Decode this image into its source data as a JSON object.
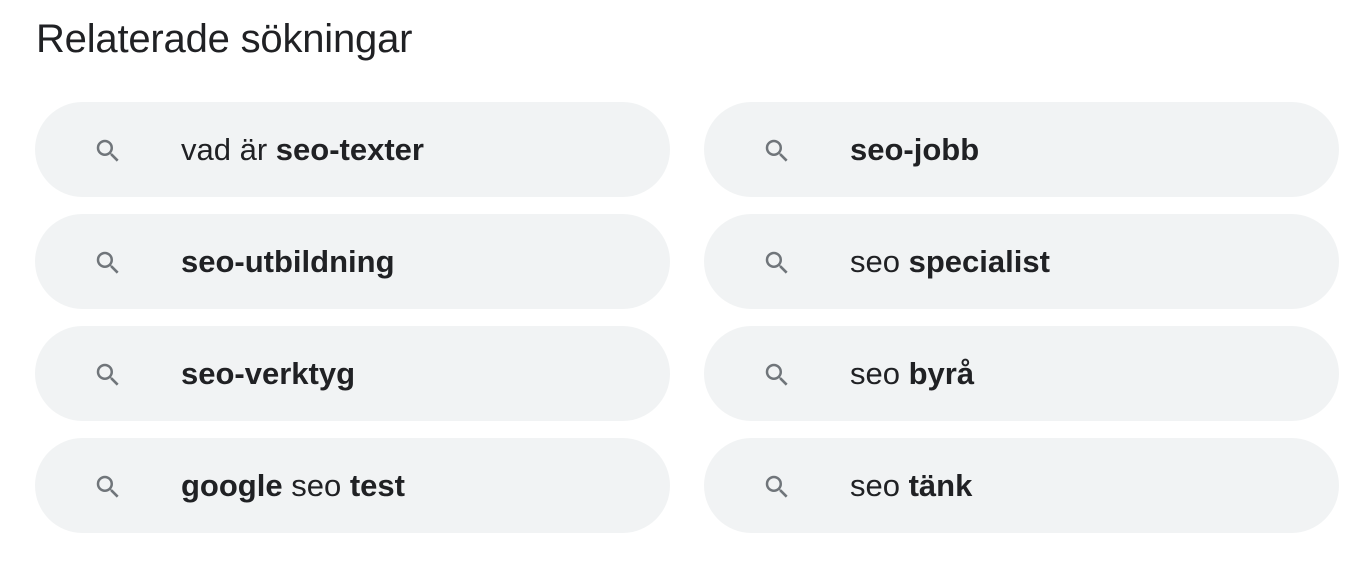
{
  "section_title": "Relaterade sökningar",
  "colors": {
    "chip_background": "#f1f3f4",
    "text": "#202124",
    "icon": "#70757a"
  },
  "icon": "search-icon",
  "items": [
    {
      "query": "vad är seo-texter",
      "segments": [
        {
          "text": "vad är ",
          "bold": false
        },
        {
          "text": "seo-texter",
          "bold": true
        }
      ]
    },
    {
      "query": "seo-jobb",
      "segments": [
        {
          "text": "seo-jobb",
          "bold": true
        }
      ]
    },
    {
      "query": "seo-utbildning",
      "segments": [
        {
          "text": "seo-utbildning",
          "bold": true
        }
      ]
    },
    {
      "query": "seo specialist",
      "segments": [
        {
          "text": "seo ",
          "bold": false
        },
        {
          "text": "specialist",
          "bold": true
        }
      ]
    },
    {
      "query": "seo-verktyg",
      "segments": [
        {
          "text": "seo-verktyg",
          "bold": true
        }
      ]
    },
    {
      "query": "seo byrå",
      "segments": [
        {
          "text": "seo ",
          "bold": false
        },
        {
          "text": "byrå",
          "bold": true
        }
      ]
    },
    {
      "query": "google seo test",
      "segments": [
        {
          "text": "google",
          "bold": true
        },
        {
          "text": " seo ",
          "bold": false
        },
        {
          "text": "test",
          "bold": true
        }
      ]
    },
    {
      "query": "seo tänk",
      "segments": [
        {
          "text": "seo ",
          "bold": false
        },
        {
          "text": "tänk",
          "bold": true
        }
      ]
    }
  ]
}
